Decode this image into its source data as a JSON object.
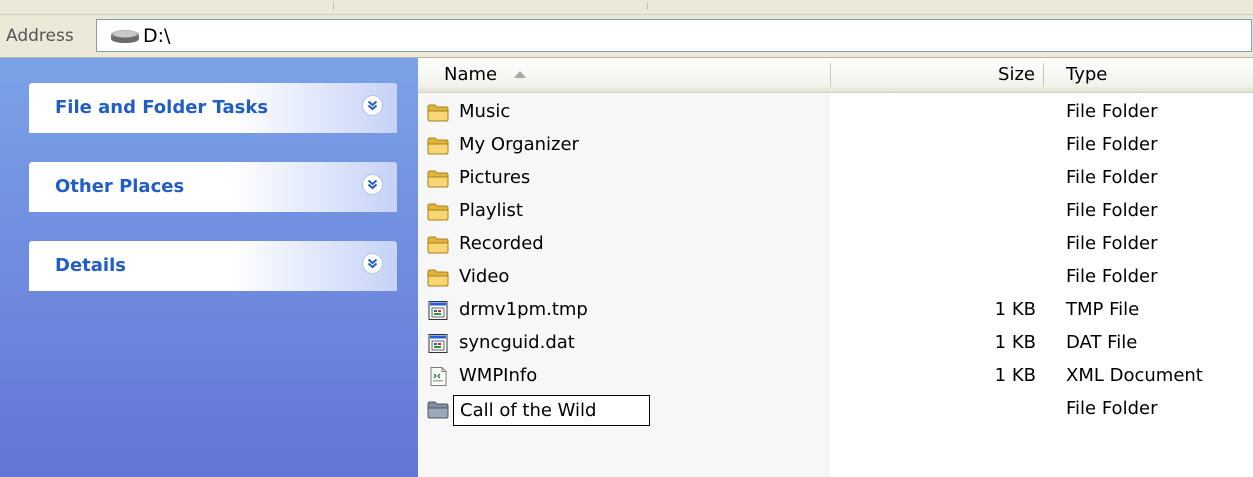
{
  "address": {
    "label": "Address",
    "path": "D:\\"
  },
  "taskpane": {
    "panels": [
      {
        "title": "File and Folder Tasks"
      },
      {
        "title": "Other Places"
      },
      {
        "title": "Details"
      }
    ]
  },
  "columns": {
    "name": "Name",
    "size": "Size",
    "type": "Type"
  },
  "files": [
    {
      "name": "Music",
      "size": "",
      "type": "File Folder",
      "icon": "folder-icon"
    },
    {
      "name": "My Organizer",
      "size": "",
      "type": "File Folder",
      "icon": "folder-icon"
    },
    {
      "name": "Pictures",
      "size": "",
      "type": "File Folder",
      "icon": "folder-icon"
    },
    {
      "name": "Playlist",
      "size": "",
      "type": "File Folder",
      "icon": "folder-icon"
    },
    {
      "name": "Recorded",
      "size": "",
      "type": "File Folder",
      "icon": "folder-icon"
    },
    {
      "name": "Video",
      "size": "",
      "type": "File Folder",
      "icon": "folder-icon"
    },
    {
      "name": "drmv1pm.tmp",
      "size": "1 KB",
      "type": "TMP File",
      "icon": "system-file-icon"
    },
    {
      "name": "syncguid.dat",
      "size": "1 KB",
      "type": "DAT File",
      "icon": "system-file-icon"
    },
    {
      "name": "WMPInfo",
      "size": "1 KB",
      "type": "XML Document",
      "icon": "xml-file-icon"
    },
    {
      "name": "Call of the Wild",
      "size": "",
      "type": "File Folder",
      "icon": "folder-icon",
      "renaming": true
    }
  ]
}
